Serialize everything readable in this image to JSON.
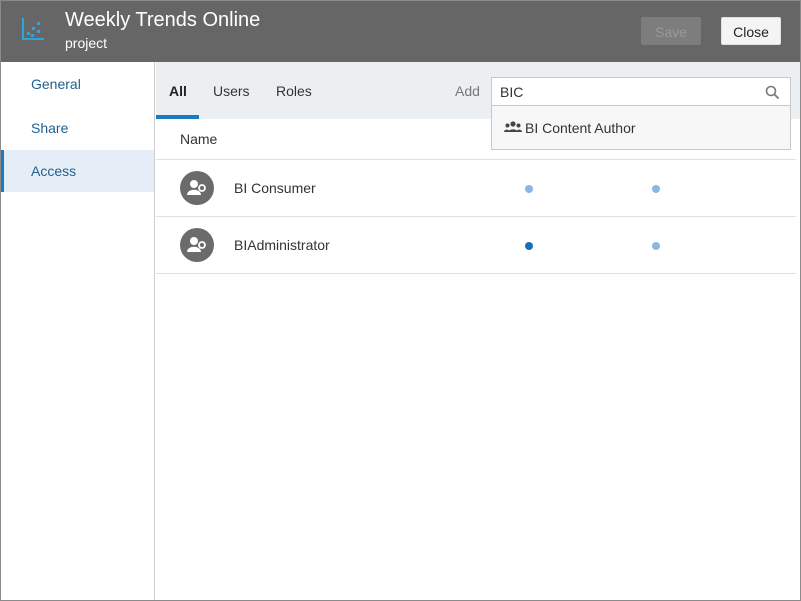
{
  "header": {
    "title": "Weekly Trends Online",
    "subtitle": "project",
    "save_label": "Save",
    "close_label": "Close",
    "icon": "chart-icon"
  },
  "sidebar": {
    "items": [
      {
        "label": "General",
        "active": false
      },
      {
        "label": "Share",
        "active": false
      },
      {
        "label": "Access",
        "active": true
      }
    ]
  },
  "tabs": {
    "items": [
      {
        "label": "All",
        "active": true
      },
      {
        "label": "Users",
        "active": false
      },
      {
        "label": "Roles",
        "active": false
      }
    ],
    "add_label": "Add"
  },
  "search": {
    "value": "BIC",
    "icon": "search-icon"
  },
  "dropdown": {
    "items": [
      {
        "label": "BI Content Author",
        "icon": "group-icon"
      }
    ]
  },
  "list": {
    "name_header": "Name",
    "rows": [
      {
        "name": "BI Consumer",
        "col1": "light",
        "col2": "light"
      },
      {
        "name": "BIAdministrator",
        "col1": "dark",
        "col2": "light"
      }
    ]
  },
  "colors": {
    "header_bg": "#666666",
    "accent": "#1a7bc1",
    "dot_light": "#8ab6e3",
    "dot_dark": "#1a70b8"
  }
}
